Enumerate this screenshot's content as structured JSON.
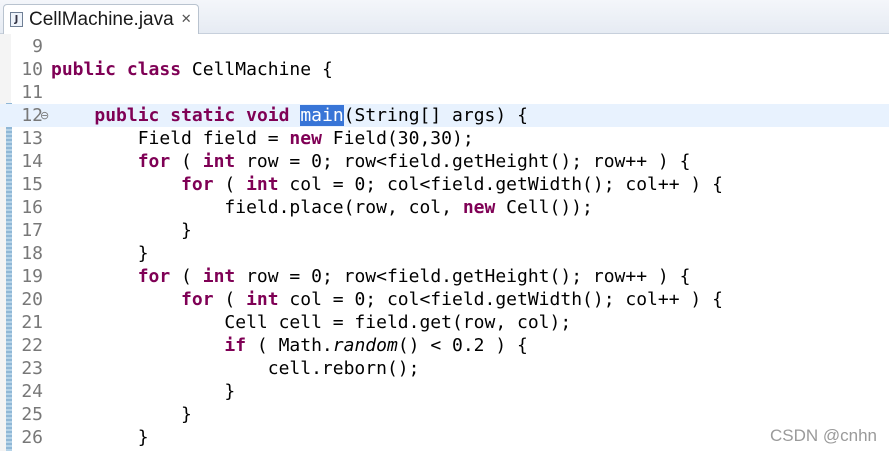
{
  "tab": {
    "title": "CellMachine.java",
    "icon": "java-file-icon",
    "close_glyph": "✕"
  },
  "editor": {
    "lines": [
      {
        "num": "9",
        "tokens": []
      },
      {
        "num": "10",
        "tokens": [
          [
            "kw",
            "public"
          ],
          [
            "t",
            " "
          ],
          [
            "kw",
            "class"
          ],
          [
            "t",
            " CellMachine {"
          ]
        ]
      },
      {
        "num": "11",
        "tokens": []
      },
      {
        "num": "12",
        "fold": "⊖",
        "current": true,
        "tokens": [
          [
            "t",
            "    "
          ],
          [
            "kw",
            "public"
          ],
          [
            "t",
            " "
          ],
          [
            "kw",
            "static"
          ],
          [
            "t",
            " "
          ],
          [
            "kw",
            "void"
          ],
          [
            "t",
            " "
          ],
          [
            "sel",
            "main"
          ],
          [
            "t",
            "(String[] args) {"
          ]
        ]
      },
      {
        "num": "13",
        "tokens": [
          [
            "t",
            "        Field field = "
          ],
          [
            "kw",
            "new"
          ],
          [
            "t",
            " Field(30,30);"
          ]
        ]
      },
      {
        "num": "14",
        "tokens": [
          [
            "t",
            "        "
          ],
          [
            "kw",
            "for"
          ],
          [
            "t",
            " ( "
          ],
          [
            "kw",
            "int"
          ],
          [
            "t",
            " row = 0; row<field.getHeight(); row++ ) {"
          ]
        ]
      },
      {
        "num": "15",
        "tokens": [
          [
            "t",
            "            "
          ],
          [
            "kw",
            "for"
          ],
          [
            "t",
            " ( "
          ],
          [
            "kw",
            "int"
          ],
          [
            "t",
            " col = 0; col<field.getWidth(); col++ ) {"
          ]
        ]
      },
      {
        "num": "16",
        "tokens": [
          [
            "t",
            "                field.place(row, col, "
          ],
          [
            "kw",
            "new"
          ],
          [
            "t",
            " Cell());"
          ]
        ]
      },
      {
        "num": "17",
        "tokens": [
          [
            "t",
            "            }"
          ]
        ]
      },
      {
        "num": "18",
        "tokens": [
          [
            "t",
            "        }"
          ]
        ]
      },
      {
        "num": "19",
        "tokens": [
          [
            "t",
            "        "
          ],
          [
            "kw",
            "for"
          ],
          [
            "t",
            " ( "
          ],
          [
            "kw",
            "int"
          ],
          [
            "t",
            " row = 0; row<field.getHeight(); row++ ) {"
          ]
        ]
      },
      {
        "num": "20",
        "tokens": [
          [
            "t",
            "            "
          ],
          [
            "kw",
            "for"
          ],
          [
            "t",
            " ( "
          ],
          [
            "kw",
            "int"
          ],
          [
            "t",
            " col = 0; col<field.getWidth(); col++ ) {"
          ]
        ]
      },
      {
        "num": "21",
        "tokens": [
          [
            "t",
            "                Cell cell = field.get(row, col);"
          ]
        ]
      },
      {
        "num": "22",
        "tokens": [
          [
            "t",
            "                "
          ],
          [
            "kw",
            "if"
          ],
          [
            "t",
            " ( Math."
          ],
          [
            "it",
            "random"
          ],
          [
            "t",
            "() < 0.2 ) {"
          ]
        ]
      },
      {
        "num": "23",
        "tokens": [
          [
            "t",
            "                    cell.reborn();"
          ]
        ]
      },
      {
        "num": "24",
        "tokens": [
          [
            "t",
            "                }"
          ]
        ]
      },
      {
        "num": "25",
        "tokens": [
          [
            "t",
            "            }"
          ]
        ]
      },
      {
        "num": "26",
        "tokens": [
          [
            "t",
            "        }"
          ]
        ]
      }
    ]
  },
  "watermark": "CSDN @cnhn",
  "colors": {
    "keyword": "#7f0055",
    "selection": "#3875d7",
    "current_line": "#e8f2fe",
    "line_number": "#787878"
  }
}
